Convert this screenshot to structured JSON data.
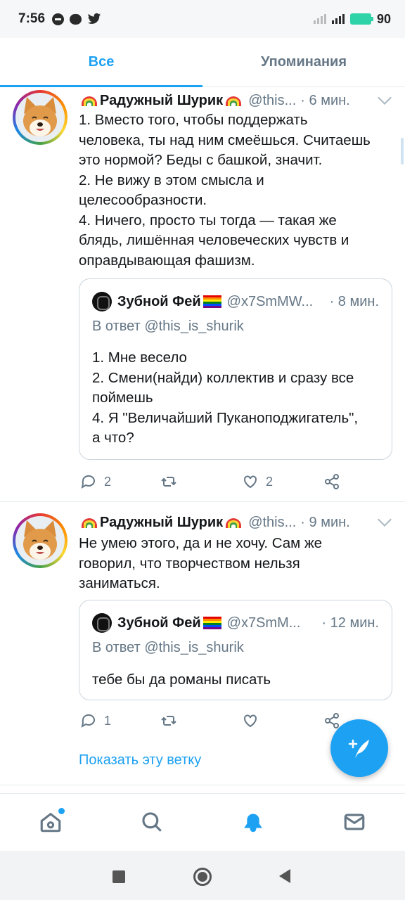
{
  "status_bar": {
    "time": "7:56",
    "battery": "90"
  },
  "tabs": [
    {
      "label": "Все",
      "active": true
    },
    {
      "label": "Упоминания",
      "active": false
    }
  ],
  "tweets": [
    {
      "author_name": "Радужный Шурик",
      "handle": "@this...",
      "time": "· 6 мин.",
      "text": "1. Вместо того, чтобы поддержать\nчеловека, ты над ним смеёшься. Считаешь\nэто нормой? Беды с башкой, значит.\n2. Не вижу в этом смысла и\nцелесообразности.\n4. Ничего, просто ты тогда — такая же\nблядь, лишённая человеческих чувств и\nоправдывающая фашизм.",
      "quote": {
        "author_name": "Зубной Фей",
        "handle": "@x7SmMW...",
        "time": "· 8 мин.",
        "reply_to": "В ответ @this_is_shurik",
        "text": "1. Мне весело\n2. Смени(найди) коллектив и сразу все\nпоймешь\n4. Я \"Величайший Пуканоподжигатель\",\nа что?"
      },
      "reply_count": "2",
      "retweet_count": "",
      "like_count": "2"
    },
    {
      "author_name": "Радужный Шурик",
      "handle": "@this...",
      "time": "· 9 мин.",
      "text": "Не умею этого, да и не хочу. Сам же\nговорил, что творчеством нельзя\nзаниматься.",
      "quote": {
        "author_name": "Зубной Фей",
        "handle": "@x7SmM...",
        "time": "· 12 мин.",
        "reply_to": "В ответ @this_is_shurik",
        "text": "тебе бы да романы писать"
      },
      "reply_count": "1",
      "retweet_count": "",
      "like_count": "",
      "show_thread": "Показать эту ветку"
    }
  ],
  "colors": {
    "accent": "#1da1f2",
    "muted": "#657786"
  },
  "icons": [
    "home-icon",
    "search-icon",
    "notifications-bell-icon",
    "messages-envelope-icon",
    "compose-feather-icon"
  ]
}
